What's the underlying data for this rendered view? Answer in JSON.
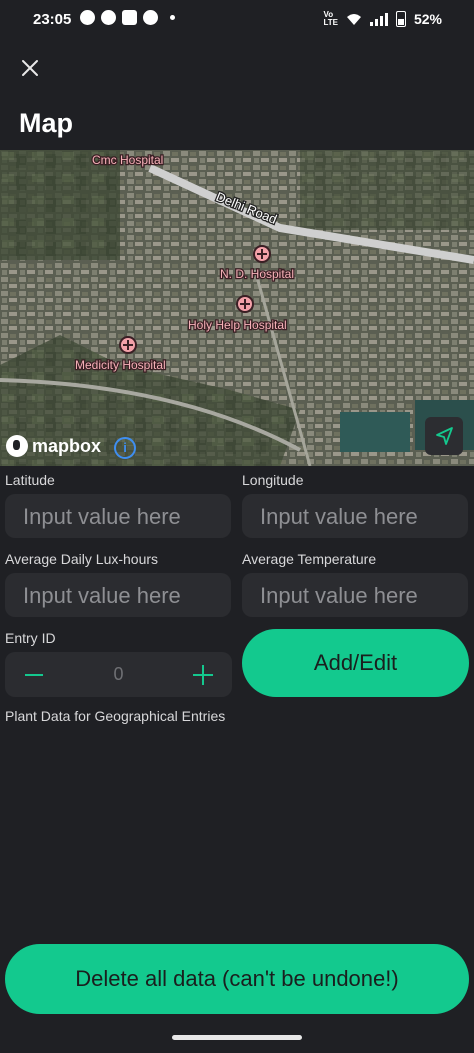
{
  "status_bar": {
    "time": "23:05",
    "battery": "52%",
    "notification_icons": [
      "whatsapp-icon",
      "chat-icon",
      "linkedin-icon",
      "app-icon"
    ],
    "system_icons": [
      "volte-icon",
      "wifi-icon",
      "signal-icon",
      "battery-icon"
    ]
  },
  "header": {
    "close_icon": "close-icon",
    "title": "Map"
  },
  "map": {
    "attribution": "mapbox",
    "places": [
      {
        "label": "Cmc Hospital"
      },
      {
        "label": "N. D. Hospital"
      },
      {
        "label": "Holy Help Hospital"
      },
      {
        "label": "Medicity Hospital"
      }
    ],
    "road": "Delhi Road",
    "poi_icon": "hospital-icon",
    "locate_icon": "location-arrow-icon",
    "info_icon": "info-icon"
  },
  "form": {
    "latitude": {
      "label": "Latitude",
      "placeholder": "Input value here",
      "value": ""
    },
    "longitude": {
      "label": "Longitude",
      "placeholder": "Input value here",
      "value": ""
    },
    "lux": {
      "label": "Average Daily Lux-hours",
      "placeholder": "Input value here",
      "value": ""
    },
    "temperature": {
      "label": "Average Temperature",
      "placeholder": "Input value here",
      "value": ""
    },
    "entry_id": {
      "label": "Entry ID",
      "value": "0"
    },
    "add_button": "Add/Edit"
  },
  "section_title": "Plant Data for Geographical Entries",
  "delete_button": "Delete all data (can't be undone!)",
  "colors": {
    "background": "#1f2024",
    "accent": "#13c98e",
    "field": "#2b2c30"
  }
}
